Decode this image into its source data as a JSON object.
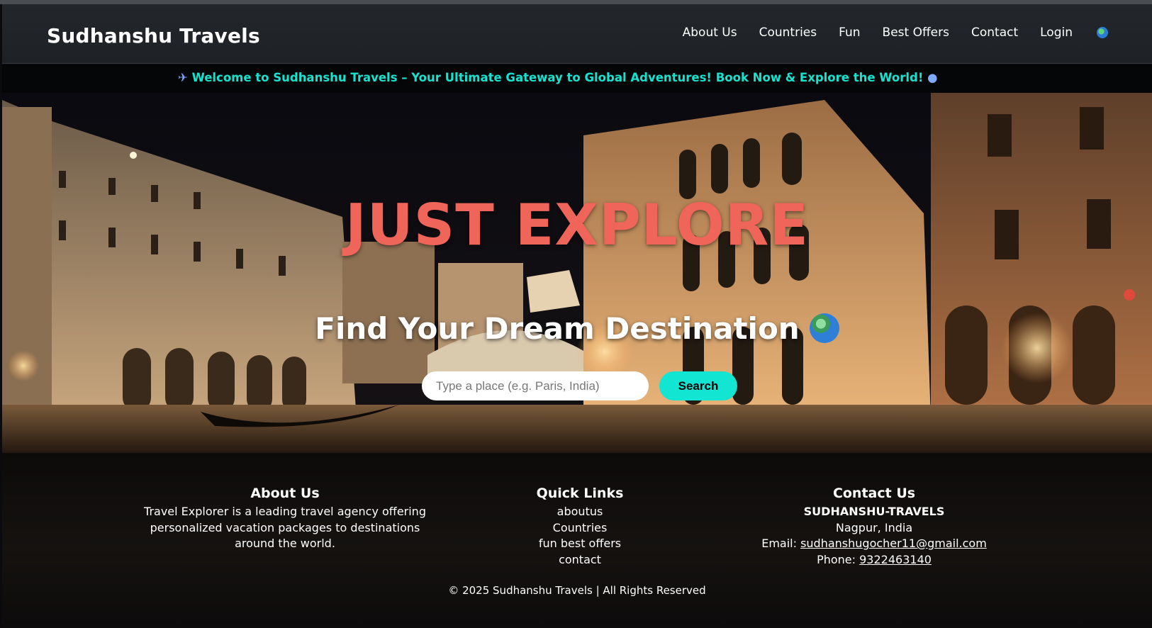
{
  "header": {
    "brand": "Sudhanshu Travels",
    "nav": [
      "About Us",
      "Countries",
      "Fun",
      "Best Offers",
      "Contact",
      "Login"
    ],
    "globe_icon": "globe-icon"
  },
  "marquee": {
    "icon": "airplane-icon",
    "text": "Welcome to Sudhanshu Travels – Your Ultimate Gateway to Global Adventures! Book Now & Explore the World!",
    "trail_icon": "globe-icon",
    "color": "#14e3d0"
  },
  "hero": {
    "title": "JUST EXPLORE",
    "subtitle": "Find Your Dream Destination",
    "subtitle_icon": "earth-globe-icon",
    "search": {
      "placeholder": "Type a place (e.g. Paris, India)",
      "value": ""
    },
    "search_button": "Search",
    "title_color": "#f0655a",
    "button_color": "#12e6d2"
  },
  "footer": {
    "about": {
      "heading": "About Us",
      "text": "Travel Explorer is a leading travel agency offering personalized vacation packages to destinations around the world."
    },
    "quick_links": {
      "heading": "Quick Links",
      "links": [
        "aboutus",
        "Countries",
        "fun best offers",
        "contact"
      ]
    },
    "contact": {
      "heading": "Contact Us",
      "company": "SUDHANSHU-TRAVELS",
      "location": "Nagpur, India",
      "email_label": "Email:",
      "email": "sudhanshugocher11@gmail.com",
      "phone_label": "Phone:",
      "phone": "9322463140"
    },
    "copyright": "© 2025 Sudhanshu Travels | All Rights Reserved"
  }
}
